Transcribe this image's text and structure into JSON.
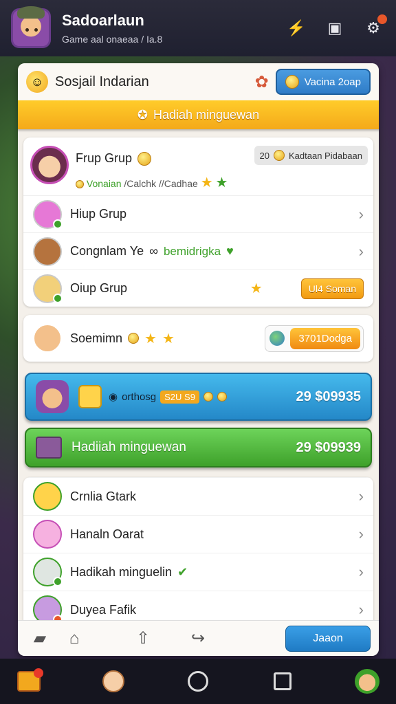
{
  "header": {
    "title": "Sadoarlaun",
    "subtitle": "Game aal onaeaa / Ia.8",
    "icons": [
      "bolt-icon",
      "badge-icon",
      "settings-icon"
    ]
  },
  "panel": {
    "title": "Sosjail Indarian",
    "top_button": "Vacina 2oap",
    "banner": "Hadiah minguewan"
  },
  "friend_card": {
    "name": "Frup Grup",
    "tags_left": "Vonaian",
    "tags_right": "/Calchk //Cadhae",
    "pill_count": "20",
    "pill_label": "Kadtaan Pidabaan",
    "rows": [
      {
        "label": "Hiup Grup",
        "extra": "",
        "green_text": ""
      },
      {
        "label": "Congnlam Ye",
        "extra": "∞",
        "green_text": "bemidrigka"
      },
      {
        "label": "Oiup Grup",
        "extra": "",
        "green_text": "",
        "button": "Ul4 Soman"
      }
    ]
  },
  "second_card": {
    "name": "Soemimn",
    "badge": "3701Dodga"
  },
  "blue_bar": {
    "label": "orthosg",
    "pill": "S2U S9",
    "value": "29 $09935"
  },
  "green_bar": {
    "label": "Hadiiah minguewan",
    "value": "29 $09939"
  },
  "list": [
    {
      "label": "Crnlia Gtark"
    },
    {
      "label": "Hanaln Oarat"
    },
    {
      "label": "Hadikah minguelin"
    },
    {
      "label": "Duyea Fafik"
    }
  ],
  "bottom_tabs": {
    "cta": "Jaaon"
  },
  "colors": {
    "accent_blue": "#2f7cc7",
    "accent_yellow": "#f4a91a",
    "accent_green": "#3ea12a"
  }
}
